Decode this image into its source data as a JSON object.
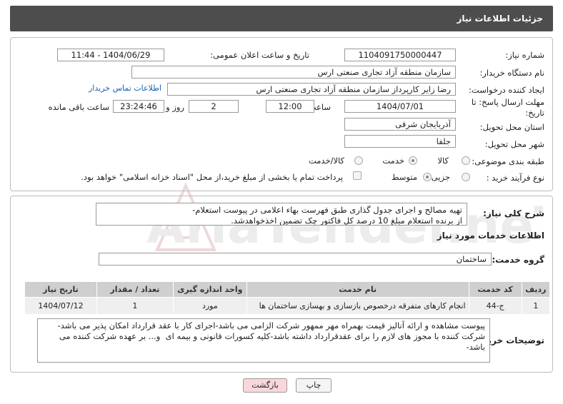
{
  "header": {
    "title": "جزئیات اطلاعات نیاز"
  },
  "form": {
    "need_number_label": "شماره نیاز:",
    "need_number": "1104091750000447",
    "announce_label": "تاریخ و ساعت اعلان عمومی:",
    "announce_value": "1404/06/29 - 11:44",
    "buyer_org_label": "نام دستگاه خریدار:",
    "buyer_org": "سازمان منطقه آزاد تجاری صنعتی ارس",
    "requester_label": "ایجاد کننده درخواست:",
    "requester": "رضا زاير كارپرداز سازمان منطقه آزاد تجاری صنعتی ارس",
    "buyer_contact_link": "اطلاعات تماس خریدار",
    "deadline_label_1": "مهلت ارسال پاسخ: تا",
    "deadline_label_2": "تاریخ:",
    "deadline_date": "1404/07/01",
    "time_label": "ساعت",
    "deadline_time": "12:00",
    "days_value": "2",
    "days_label": "روز و",
    "remaining_time": "23:24:46",
    "remaining_label": "ساعت باقی مانده",
    "province_label": "استان محل تحویل:",
    "province": "آذربایجان شرقی",
    "city_label": "شهر محل تحویل:",
    "city": "جلفا",
    "category_label": "طبقه بندی موضوعی:",
    "category_options": [
      "کالا",
      "خدمت",
      "کالا/خدمت"
    ],
    "category_selected": "خدمت",
    "process_label": "نوع فرآیند خرید :",
    "process_options": [
      "جزیی",
      "متوسط"
    ],
    "process_selected": "متوسط",
    "payment_note": "پرداخت تمام یا بخشی از مبلغ خرید،از محل \"اسناد خزانه اسلامی\" خواهد بود."
  },
  "description": {
    "label": "شرح کلی نیاز:",
    "text": "تهیه مصالح و اجرای جدول گذاری طبق فهرست بهاء اعلامی در پیوست استعلام-\nاز برنده استعلام مبلغ 10 درصد کل فاکتور چک تضمین اخذخواهدشد."
  },
  "services": {
    "section_title": "اطلاعات خدمات مورد نیاز",
    "group_label": "گروه خدمت:",
    "group_value": "ساختمان",
    "columns": [
      "ردیف",
      "کد خدمت",
      "نام خدمت",
      "واحد اندازه گیری",
      "تعداد / مقدار",
      "تاریخ نیاز"
    ],
    "rows": [
      [
        "1",
        "ج-44",
        "انجام کارهای متفرقه درخصوص بازسازی و بهسازی ساختمان ها",
        "مورد",
        "1",
        "1404/07/12"
      ]
    ]
  },
  "buyer_notes": {
    "label": "توضیحات خریدار:",
    "text": "پیوست مشاهده و ارائه آنالیز قیمت بهمراه مهر ممهور شرکت الزامی می باشد-اجرای کار با عقد قرارداد امکان پذیر می باشد-شرکت کننده با مجوز های لازم را برای عقدقرارداد داشته باشد-کلیه کسورات قانونی و بیمه ای  و... بر عهده شرکت کننده می باشد-"
  },
  "buttons": {
    "print": "چاپ",
    "back": "بازگشت"
  },
  "watermark": "AriaTender.neT",
  "colors": {
    "header_bg": "#4d4d4d",
    "link": "#1a5fb4",
    "back_button_bg": "#f8d7da"
  }
}
